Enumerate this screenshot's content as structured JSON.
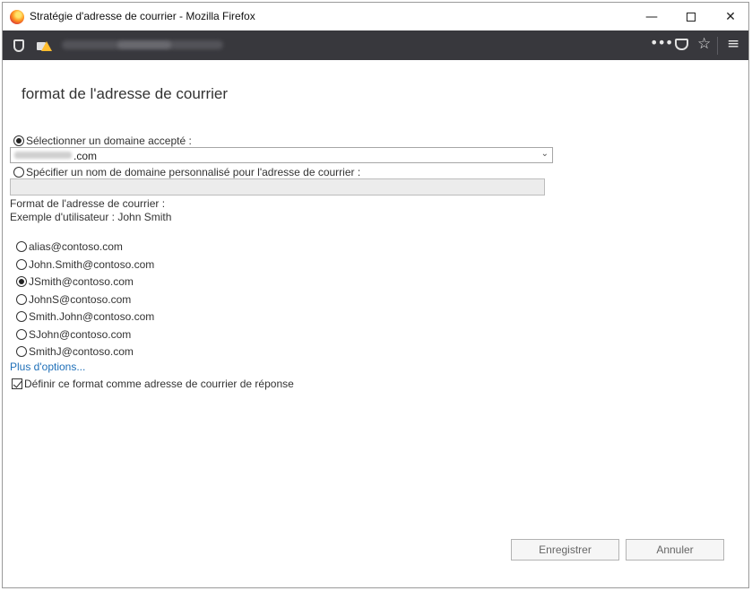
{
  "window": {
    "title": "Stratégie d'adresse de courrier - Mozilla Firefox",
    "minimize_glyph": "—",
    "close_glyph": "✕"
  },
  "navbar": {
    "more_glyph": "•••",
    "star_glyph": "☆",
    "menu_glyph": "≡"
  },
  "page": {
    "title": "format de l'adresse de courrier"
  },
  "domain": {
    "select_accepted_label": "Sélectionner un domaine accepté :",
    "select_accepted_checked": true,
    "selected_domain_suffix": ".com",
    "custom_label": "Spécifier un nom de domaine personnalisé pour l'adresse de courrier :",
    "custom_checked": false,
    "custom_value": ""
  },
  "format": {
    "heading": "Format de l'adresse de courrier :",
    "example": "Exemple d'utilisateur : John Smith",
    "options": [
      {
        "label": "alias@contoso.com",
        "checked": false
      },
      {
        "label": "John.Smith@contoso.com",
        "checked": false
      },
      {
        "label": "JSmith@contoso.com",
        "checked": true
      },
      {
        "label": "JohnS@contoso.com",
        "checked": false
      },
      {
        "label": "Smith.John@contoso.com",
        "checked": false
      },
      {
        "label": "SJohn@contoso.com",
        "checked": false
      },
      {
        "label": "SmithJ@contoso.com",
        "checked": false
      }
    ],
    "more_options": "Plus d'options...",
    "reply_label": "Définir ce format comme adresse de courrier de réponse",
    "reply_checked": true
  },
  "buttons": {
    "save": "Enregistrer",
    "cancel": "Annuler"
  },
  "colors": {
    "link": "#1e6fb8",
    "navbar": "#38383d"
  }
}
